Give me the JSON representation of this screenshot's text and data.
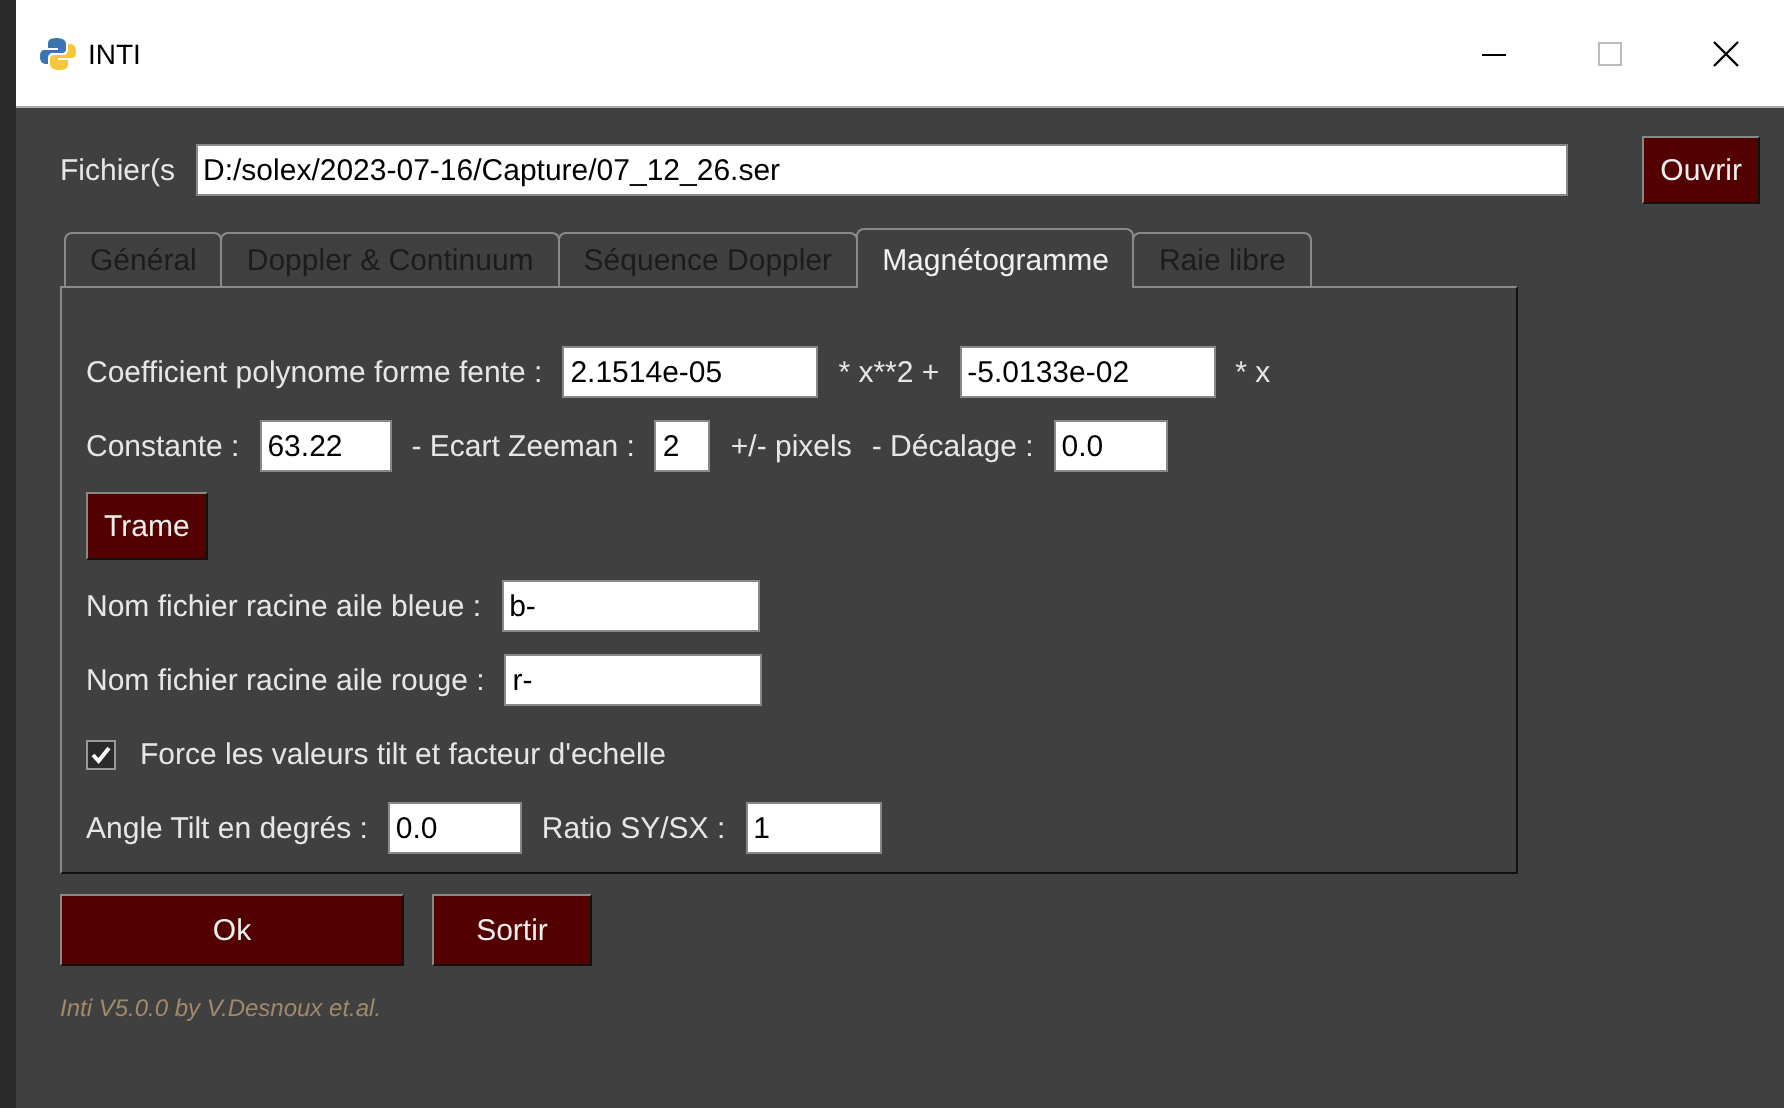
{
  "window": {
    "title": "INTI"
  },
  "file": {
    "label": "Fichier(s",
    "value": "D:/solex/2023-07-16/Capture/07_12_26.ser",
    "button": "Ouvrir"
  },
  "tabs": [
    {
      "label": "Général",
      "selected": false
    },
    {
      "label": "Doppler & Continuum",
      "selected": false
    },
    {
      "label": "Séquence Doppler",
      "selected": false
    },
    {
      "label": "Magnétogramme",
      "selected": true
    },
    {
      "label": "Raie libre",
      "selected": false
    }
  ],
  "rows": [
    {
      "items": [
        {
          "kind": "label",
          "text": "Coefficient polynome forme fente :"
        },
        {
          "kind": "field",
          "value": "2.1514e-05"
        },
        {
          "kind": "label",
          "text": "* x**2 +"
        },
        {
          "kind": "field",
          "value": "-5.0133e-02"
        },
        {
          "kind": "label",
          "text": "* x"
        }
      ]
    },
    {
      "items": [
        {
          "kind": "label",
          "text": "Constante :"
        },
        {
          "kind": "field",
          "value": "63.22"
        },
        {
          "kind": "label",
          "text": "- Ecart Zeeman :"
        },
        {
          "kind": "field",
          "value": "2"
        },
        {
          "kind": "label",
          "text": "+/- pixels"
        },
        {
          "kind": "label",
          "text": "- Décalage :"
        },
        {
          "kind": "field",
          "value": "0.0"
        }
      ]
    },
    {
      "items": [
        {
          "kind": "button",
          "text": "Trame"
        }
      ]
    },
    {
      "items": [
        {
          "kind": "label",
          "text": "Nom fichier racine aile bleue :"
        },
        {
          "kind": "field",
          "value": "b-"
        }
      ]
    },
    {
      "items": [
        {
          "kind": "label",
          "text": "Nom fichier racine aile rouge :"
        },
        {
          "kind": "field",
          "value": "r-"
        }
      ]
    },
    {
      "items": [
        {
          "kind": "checkbox",
          "text": "Force les valeurs tilt et facteur d'echelle",
          "checked": true
        }
      ]
    },
    {
      "items": [
        {
          "kind": "label",
          "text": "Angle Tilt en degrés :"
        },
        {
          "kind": "field",
          "value": "0.0"
        },
        {
          "kind": "label",
          "text": "Ratio SY/SX :"
        },
        {
          "kind": "field",
          "value": "1"
        }
      ]
    }
  ],
  "buttons": [
    {
      "text": "Ok"
    },
    {
      "text": "Sortir"
    }
  ],
  "footer": "Inti V5.0.0 by V.Desnoux et.al."
}
